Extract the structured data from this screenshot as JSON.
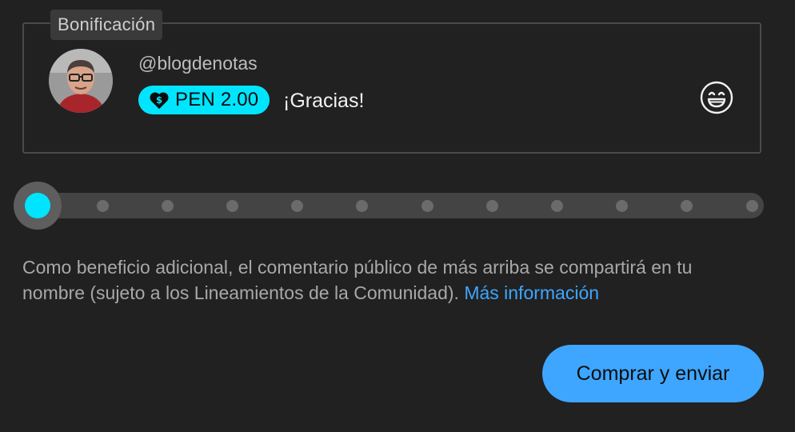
{
  "card": {
    "legend": "Bonificación",
    "username": "@blogdenotas",
    "amount": "PEN 2.00",
    "message": "¡Gracias!",
    "emoji_icon": "grinning-face-icon",
    "amount_icon": "heart-dollar-icon",
    "chip_color": "#00e5ff"
  },
  "slider": {
    "steps": 12,
    "selected_index": 0,
    "accent": "#00e5ff"
  },
  "info": {
    "text": "Como beneficio adicional, el comentario público de más arriba se compartirá en tu nombre (sujeto a los Lineamientos de la Comunidad).",
    "link": "Más información",
    "link_color": "#3ea6ff"
  },
  "actions": {
    "buy_label": "Comprar y enviar",
    "buy_color": "#3ea6ff"
  }
}
